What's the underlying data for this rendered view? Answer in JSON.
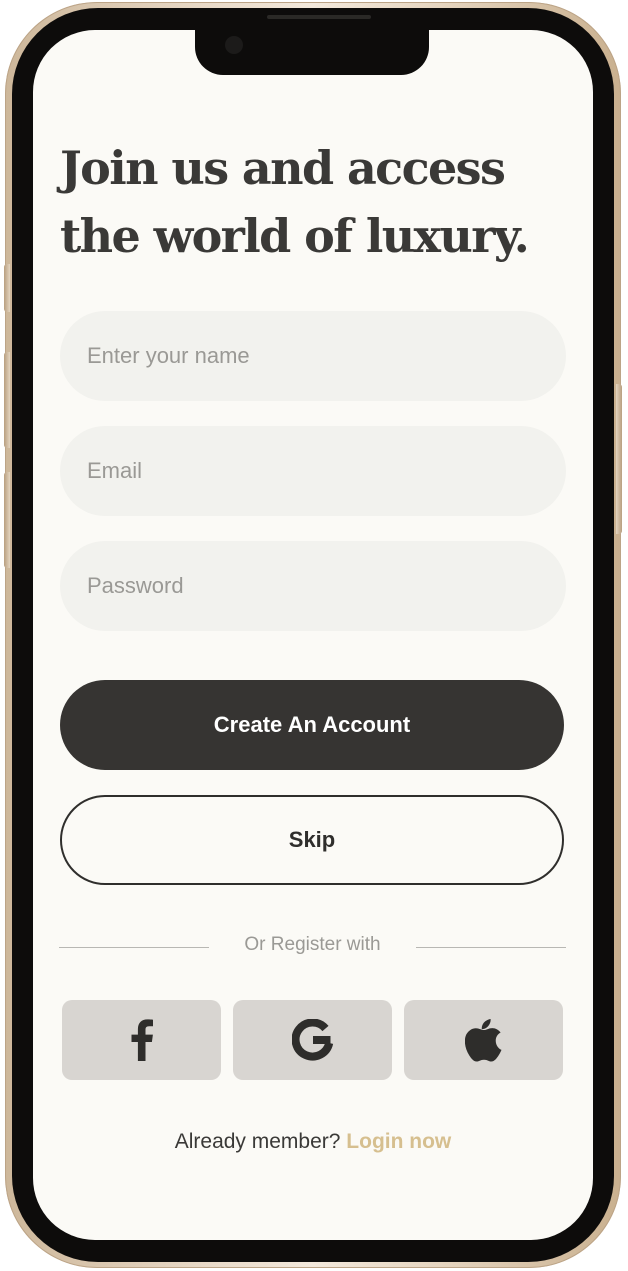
{
  "screen": {
    "title_line1": "Join us and access",
    "title_line2": "the world of luxury."
  },
  "form": {
    "name_placeholder": "Enter your name",
    "name_value": "",
    "email_placeholder": "Email",
    "email_value": "",
    "password_placeholder": "Password",
    "password_value": ""
  },
  "actions": {
    "create_label": "Create An Account",
    "skip_label": "Skip"
  },
  "social": {
    "divider_text": "Or Register with",
    "providers": [
      {
        "name": "facebook",
        "icon": "facebook-icon"
      },
      {
        "name": "google",
        "icon": "google-icon"
      },
      {
        "name": "apple",
        "icon": "apple-icon"
      }
    ]
  },
  "footer": {
    "prompt": "Already member?",
    "login_label": "Login now"
  },
  "colors": {
    "background": "#fbfaf6",
    "primary_button": "#363432",
    "accent": "#d6bf8f",
    "field_bg": "#f2f2ee",
    "social_bg": "#d8d5d1"
  }
}
